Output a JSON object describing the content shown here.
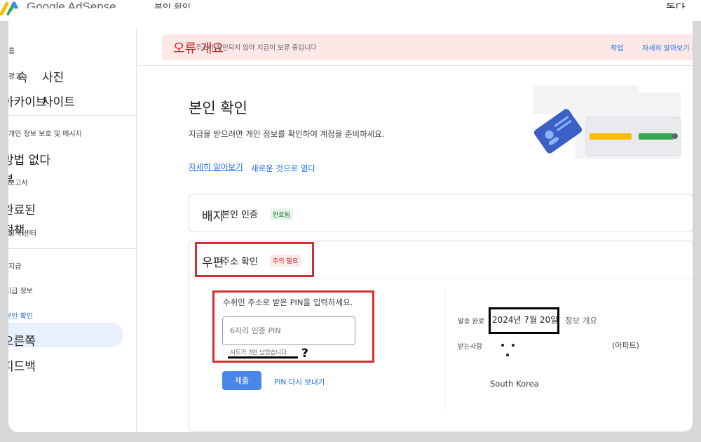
{
  "topbar": {
    "logo_text": "Google AdSense",
    "page_title": "본인 확인",
    "right_overlay": "돕다"
  },
  "sidebar": {
    "items": [
      {
        "label": "홈"
      },
      {
        "label": "광고"
      },
      {
        "label": "개인 정보 보호 및 메시지"
      },
      {
        "label": "보고서"
      },
      {
        "label": "정책 센터"
      },
      {
        "label": "지급"
      },
      {
        "label": "지급 정보"
      },
      {
        "label": "본인 확인"
      }
    ],
    "overlays": [
      "속",
      "사진",
      "아카이브",
      "사이트",
      "방법 없다",
      "부",
      "완료된",
      "정책",
      "보고서",
      "오른쪽",
      "피드백"
    ]
  },
  "error_banner": {
    "overlay": "오류 개요",
    "message": "주소가 확인되지 않아 지급이 보류 중입니다",
    "action1": "작업",
    "action2": "자세히 알아보기 새로운"
  },
  "main": {
    "title": "본인 확인",
    "description": "지급을 받으려면 개인 정보를 확인하여 계정을 준비하세요.",
    "learn_more": "자세히 알아보기",
    "learn_more_overlay": "새로운 것으로 열다"
  },
  "identity_card": {
    "overlay": "배지",
    "title": "본인 인증",
    "badge": "완료됨"
  },
  "address_card": {
    "overlay": "우편",
    "title": "주소 확인",
    "badge": "주의 필요",
    "pin_instruction": "수취인 주소로 받은 PIN을 입력하세요.",
    "pin_placeholder": "6자리 인증 PIN",
    "attempts_hint": "시도가 3번 남았습니다.",
    "annotation": "?",
    "submit_label": "제출",
    "resend_label": "PIN 다시 보내기",
    "sent_label": "발송 완료",
    "sent_date": "2024년 7월 20일",
    "sent_extra": "정보 개요",
    "recipient_label": "받는사람",
    "address_tail": "(아파트)",
    "country": "South Korea"
  },
  "colors": {
    "accent": "#1a73e8",
    "error_bg": "#fce8e6",
    "error_text": "#c5221f",
    "success_bg": "#e6f4ea",
    "annotation_red": "#d32f2f"
  }
}
